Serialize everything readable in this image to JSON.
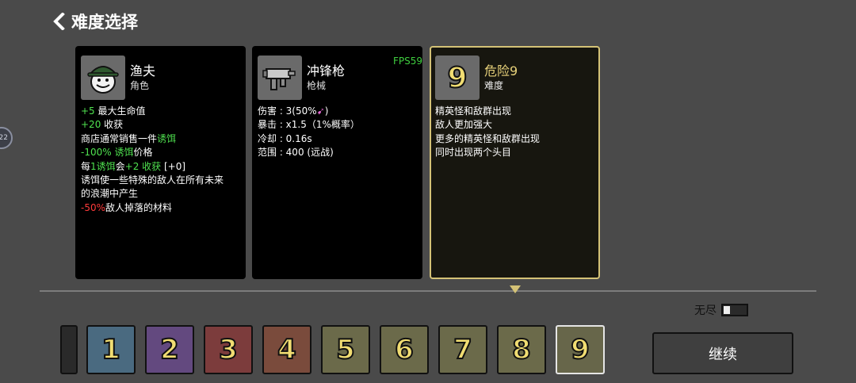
{
  "header": {
    "title": "难度选择"
  },
  "left_edge_badge": "22",
  "fps": "FPS59",
  "cards": [
    {
      "name": "渔夫",
      "type": "角色",
      "lines": [
        [
          {
            "t": "+5",
            "c": "g"
          },
          {
            "t": " 最大生命值",
            "c": ""
          }
        ],
        [
          {
            "t": "+20",
            "c": "g"
          },
          {
            "t": " 收获",
            "c": ""
          }
        ],
        [
          {
            "t": "商店通常销售一件",
            "c": ""
          },
          {
            "t": "诱饵",
            "c": "g"
          }
        ],
        [
          {
            "t": "-100% 诱饵",
            "c": "g"
          },
          {
            "t": "价格",
            "c": ""
          }
        ],
        [
          {
            "t": "每",
            "c": ""
          },
          {
            "t": "1诱饵",
            "c": "g"
          },
          {
            "t": "会",
            "c": ""
          },
          {
            "t": "+2 收获",
            "c": "g"
          },
          {
            "t": " [+0]",
            "c": ""
          }
        ],
        [
          {
            "t": "诱饵使一些特殊的敌人在所有未来",
            "c": ""
          }
        ],
        [
          {
            "t": "的浪潮中产生",
            "c": ""
          }
        ],
        [
          {
            "t": "-50%",
            "c": "r"
          },
          {
            "t": "敌人掉落的材料",
            "c": ""
          }
        ]
      ]
    },
    {
      "name": "冲锋枪",
      "type": "枪械",
      "lines": [
        [
          {
            "t": "伤害 : 3(50%",
            "c": ""
          },
          {
            "t": "➹",
            "c": "pink"
          },
          {
            "t": ")",
            "c": ""
          }
        ],
        [
          {
            "t": "暴击 : x1.5（1%概率）",
            "c": ""
          }
        ],
        [
          {
            "t": "冷却 : 0.16s",
            "c": ""
          }
        ],
        [
          {
            "t": "范围 : 400 (远战)",
            "c": ""
          }
        ]
      ]
    },
    {
      "name": "危险9",
      "type": "难度",
      "lines": [
        [
          {
            "t": "精英怪和敌群出现",
            "c": ""
          }
        ],
        [
          {
            "t": "敌人更加强大",
            "c": ""
          }
        ],
        [
          {
            "t": "更多的精英怪和敌群出现",
            "c": ""
          }
        ],
        [
          {
            "t": "同时出现两个头目",
            "c": ""
          }
        ]
      ]
    }
  ],
  "danger_portrait_number": "9",
  "endless": {
    "label": "无尽",
    "on": false
  },
  "difficulty_slots": [
    {
      "num": "1",
      "color": "#4a6a80"
    },
    {
      "num": "2",
      "color": "#63497f"
    },
    {
      "num": "3",
      "color": "#7c3c3c"
    },
    {
      "num": "4",
      "color": "#7a4b3c"
    },
    {
      "num": "5",
      "color": "#6b6a4a"
    },
    {
      "num": "6",
      "color": "#6b6a4a"
    },
    {
      "num": "7",
      "color": "#6b6a4a"
    },
    {
      "num": "8",
      "color": "#6b6a4a"
    },
    {
      "num": "9",
      "color": "#67664a"
    }
  ],
  "selected_difficulty": "9",
  "continue_label": "继续"
}
